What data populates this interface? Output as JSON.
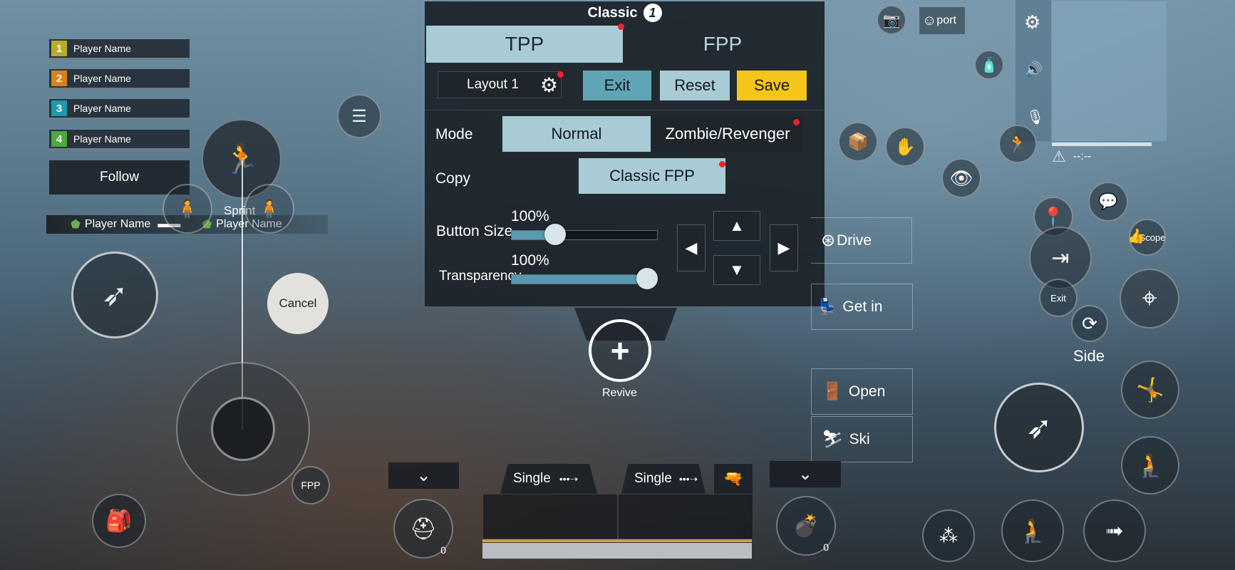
{
  "team": {
    "players": [
      {
        "num": "1",
        "name": "Player Name",
        "color": "#b5ad2a"
      },
      {
        "num": "2",
        "name": "Player Name",
        "color": "#d9821a"
      },
      {
        "num": "3",
        "name": "Player Name",
        "color": "#1f98b0"
      },
      {
        "num": "4",
        "name": "Player Name",
        "color": "#4ea83a"
      }
    ],
    "follow_label": "Follow"
  },
  "killfeed": {
    "left_name": "Player Name",
    "right_name": "Player Name"
  },
  "controls": {
    "sprint_label": "Sprint",
    "cancel_label": "Cancel",
    "fpp_label": "FPP",
    "revive_label": "Revive",
    "report_label": "port",
    "scope_label": "Scope",
    "side_label": "Side",
    "exit_label": "Exit",
    "timer_text": "--:--"
  },
  "panel": {
    "title": "Classic",
    "badge": "1",
    "tabs": {
      "tpp": "TPP",
      "fpp": "FPP"
    },
    "layout_label": "Layout 1",
    "exit_label": "Exit",
    "reset_label": "Reset",
    "save_label": "Save",
    "mode_label": "Mode",
    "mode_normal": "Normal",
    "mode_zombie": "Zombie/Revenger",
    "copy_label": "Copy",
    "copy_value": "Classic FPP",
    "button_size_label": "Button Size",
    "button_size_value": "100%",
    "button_size_level": 0.3,
    "transparency_label": "Transparency",
    "transparency_value": "100%",
    "transparency_level": 1.0
  },
  "actions": {
    "drive": "Drive",
    "get_in": "Get in",
    "open": "Open",
    "ski": "Ski"
  },
  "weapons": {
    "slot1_mode": "Single",
    "slot2_mode": "Single",
    "medkit_count": "0",
    "grenade_count": "0"
  },
  "colors": {
    "save": "#f5c518",
    "exit": "#5fa5b5",
    "reset": "#a9cbd6",
    "tab_active": "#a9cbd6",
    "red_dot": "#e8242f"
  }
}
